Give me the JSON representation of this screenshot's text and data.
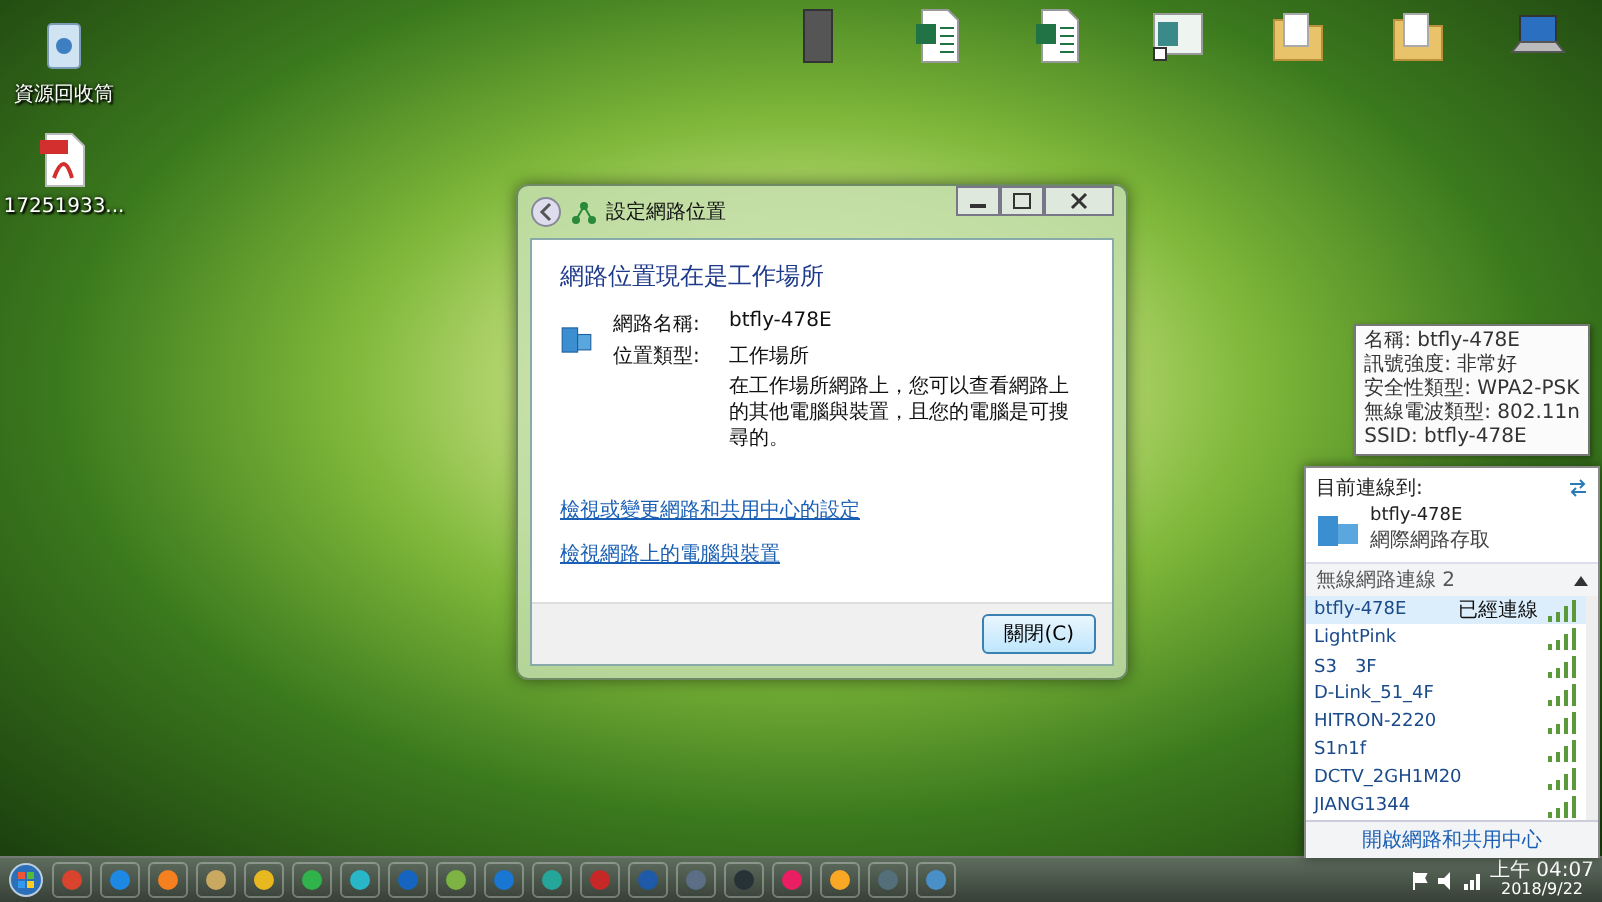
{
  "desktop": {
    "left_icons": [
      {
        "kind": "trash",
        "label": "資源回收筒"
      },
      {
        "kind": "pdf",
        "label": "17251933..."
      }
    ],
    "right_icons": [
      {
        "kind": "file"
      },
      {
        "kind": "sheet"
      },
      {
        "kind": "sheet"
      },
      {
        "kind": "shortcut"
      },
      {
        "kind": "folder"
      },
      {
        "kind": "folder"
      },
      {
        "kind": "laptop"
      }
    ]
  },
  "dialog": {
    "title": "設定網路位置",
    "heading": "網路位置現在是工作場所",
    "fields": [
      {
        "label": "網路名稱:",
        "value": "btfly-478E"
      },
      {
        "label": "位置類型:",
        "value": "工作場所"
      }
    ],
    "description": "在工作場所網路上，您可以查看網路上的其他電腦與裝置，且您的電腦是可搜尋的。",
    "links": [
      "檢視或變更網路和共用中心的設定",
      "檢視網路上的電腦與裝置"
    ],
    "button": "關閉(C)"
  },
  "popup": {
    "header": "目前連線到:",
    "current": {
      "name": "btfly-478E",
      "access": "網際網路存取"
    },
    "section": "無線網路連線 2",
    "networks": [
      {
        "name": "btfly-478E",
        "status": "已經連線",
        "selected": true
      },
      {
        "name": "LightPink",
        "selected": false
      },
      {
        "name": "S3　3F",
        "selected": false
      },
      {
        "name": "D-Link_51_4F",
        "selected": false
      },
      {
        "name": "HITRON-2220",
        "selected": false
      },
      {
        "name": "S1n1f",
        "selected": false
      },
      {
        "name": "DCTV_2GH1M20",
        "selected": false
      },
      {
        "name": "JIANG1344",
        "selected": false
      }
    ],
    "tooltip": [
      "名稱: btfly-478E",
      "訊號強度: 非常好",
      "安全性類型: WPA2-PSK",
      "無線電波類型: 802.11n",
      "SSID: btfly-478E"
    ],
    "footer": "開啟網路和共用中心"
  },
  "taskbar": {
    "apps": [
      {
        "color": "#d9442f"
      },
      {
        "color": "#1e88e5"
      },
      {
        "color": "#f4801f"
      },
      {
        "color": "#c9a860"
      },
      {
        "color": "#e8b820"
      },
      {
        "color": "#2fb34a"
      },
      {
        "color": "#29b6c8"
      },
      {
        "color": "#1565c0"
      },
      {
        "color": "#7cb342"
      },
      {
        "color": "#1976d2"
      },
      {
        "color": "#26a69a"
      },
      {
        "color": "#c62828"
      },
      {
        "color": "#1e5aa8"
      },
      {
        "color": "#5a6e86"
      },
      {
        "color": "#263238"
      },
      {
        "color": "#e91e63"
      },
      {
        "color": "#f9a825"
      },
      {
        "color": "#546e7a"
      },
      {
        "color": "#4a90c8"
      }
    ],
    "time": "上午 04:07",
    "date": "2018/9/22"
  }
}
